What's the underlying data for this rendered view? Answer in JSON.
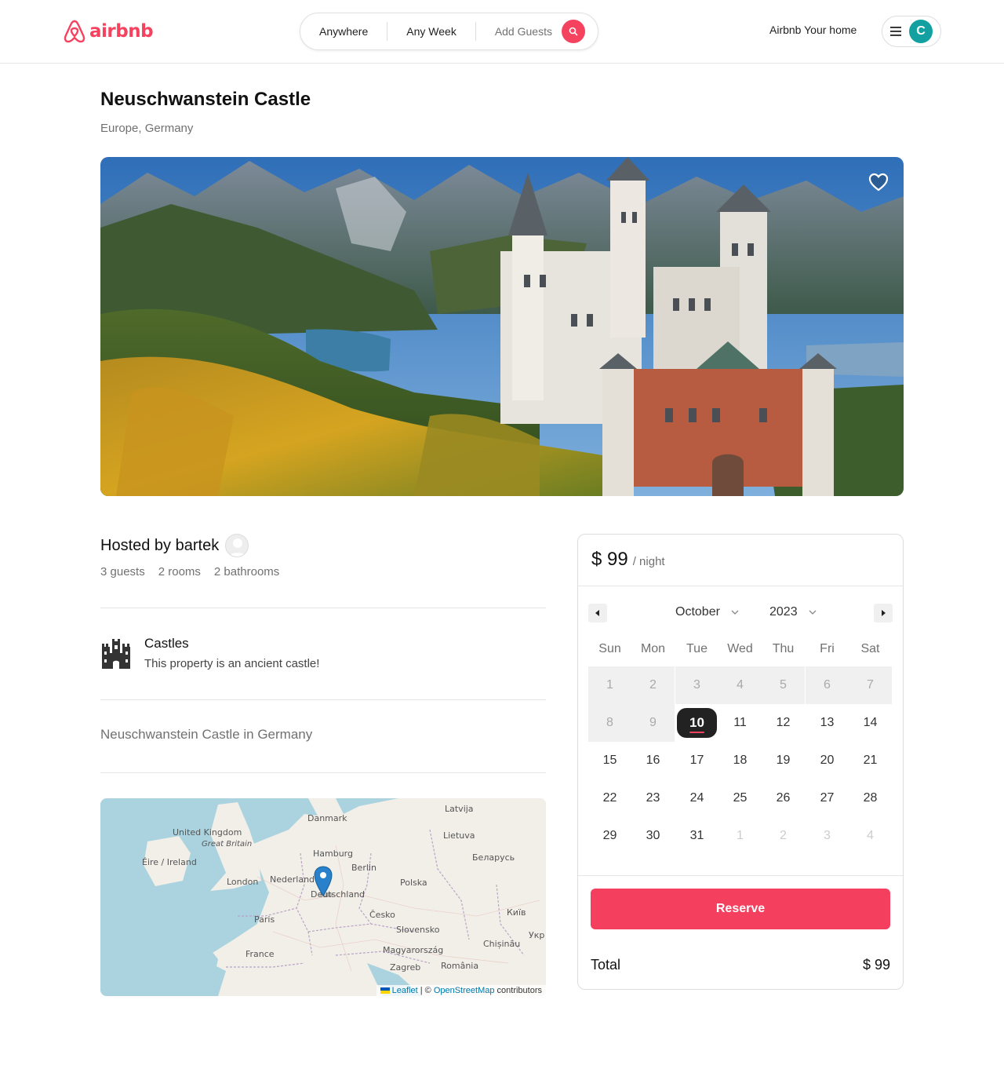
{
  "header": {
    "logo_text": "airbnb",
    "search": {
      "where": "Anywhere",
      "when": "Any Week",
      "who": "Add Guests"
    },
    "host_link": "Airbnb Your home",
    "user_initial": "C"
  },
  "listing": {
    "title": "Neuschwanstein Castle",
    "location": "Europe, Germany",
    "host_label": "Hosted by bartek",
    "stats": [
      "3 guests",
      "2 rooms",
      "2 bathrooms"
    ],
    "category": {
      "name": "Castles",
      "description": "This property is an ancient castle!"
    },
    "description": "Neuschwanstein Castle in Germany"
  },
  "map": {
    "labels": [
      "Latvija",
      "Danmark",
      "Lietuva",
      "United Kingdom",
      "Great Britain",
      "Éire / Ireland",
      "Hamburg",
      "Беларусь",
      "Berlin",
      "London",
      "Nederland",
      "Polska",
      "Deutschland",
      "Київ",
      "Česko",
      "Paris",
      "Slovensko",
      "Укр",
      "Chișinău",
      "Magyarország",
      "France",
      "Zagreb",
      "România"
    ],
    "attribution": {
      "leaflet": "Leaflet",
      "sep": " | © ",
      "osm": "OpenStreetMap",
      "suffix": " contributors"
    }
  },
  "booking": {
    "price": "$ 99",
    "per": "/ night",
    "month": "October",
    "year": "2023",
    "weekdays": [
      "Sun",
      "Mon",
      "Tue",
      "Wed",
      "Thu",
      "Fri",
      "Sat"
    ],
    "selected_day": "10",
    "reserve_label": "Reserve",
    "total_label": "Total",
    "total_value": "$ 99"
  },
  "colors": {
    "brand": "#f5425f",
    "avatar": "#12a0a0"
  }
}
